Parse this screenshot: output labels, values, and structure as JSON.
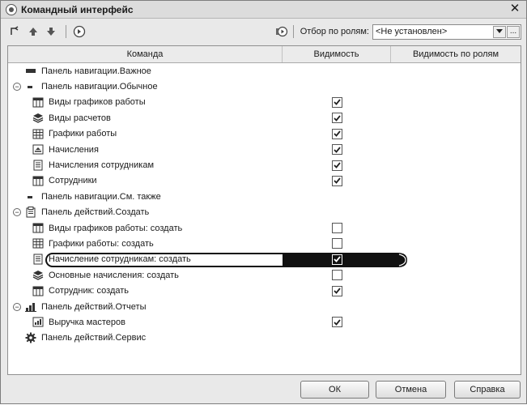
{
  "window": {
    "title": "Командный интерфейс"
  },
  "toolbar": {
    "filter_label": "Отбор по ролям:",
    "filter_value": "<Не установлен>"
  },
  "grid": {
    "headers": {
      "command": "Команда",
      "visibility": "Видимость",
      "role_visibility": "Видимость по ролям"
    },
    "rows": [
      {
        "label": "Панель навигации.Важное",
        "indent": 0,
        "expander": "",
        "icon": "panel-bar-icon",
        "check": null
      },
      {
        "label": "Панель навигации.Обычное",
        "indent": 0,
        "expander": "−",
        "icon": "panel-bar-small-icon",
        "check": null
      },
      {
        "label": "Виды графиков работы",
        "indent": 1,
        "expander": "",
        "icon": "catalog-icon",
        "check": true
      },
      {
        "label": "Виды расчетов",
        "indent": 1,
        "expander": "",
        "icon": "chart-of-calc-icon",
        "check": true
      },
      {
        "label": "Графики работы",
        "indent": 1,
        "expander": "",
        "icon": "register-icon",
        "check": true
      },
      {
        "label": "Начисления",
        "indent": 1,
        "expander": "",
        "icon": "calc-register-icon",
        "check": true
      },
      {
        "label": "Начисления сотрудникам",
        "indent": 1,
        "expander": "",
        "icon": "document-icon",
        "check": true
      },
      {
        "label": "Сотрудники",
        "indent": 1,
        "expander": "",
        "icon": "catalog-icon",
        "check": true
      },
      {
        "label": "Панель навигации.См. также",
        "indent": 0,
        "expander": "",
        "icon": "panel-bar-small-icon",
        "check": null
      },
      {
        "label": "Панель действий.Создать",
        "indent": 0,
        "expander": "−",
        "icon": "create-icon",
        "check": null
      },
      {
        "label": "Виды графиков работы: создать",
        "indent": 1,
        "expander": "",
        "icon": "catalog-icon",
        "check": false
      },
      {
        "label": "Графики работы: создать",
        "indent": 1,
        "expander": "",
        "icon": "register-icon",
        "check": false
      },
      {
        "label": "Начисление сотрудникам: создать",
        "indent": 1,
        "expander": "",
        "icon": "document-icon",
        "check": true,
        "selected": true
      },
      {
        "label": "Основные начисления: создать",
        "indent": 1,
        "expander": "",
        "icon": "chart-of-calc-icon",
        "check": false
      },
      {
        "label": "Сотрудник: создать",
        "indent": 1,
        "expander": "",
        "icon": "catalog-icon",
        "check": true
      },
      {
        "label": "Панель действий.Отчеты",
        "indent": 0,
        "expander": "−",
        "icon": "reports-icon",
        "check": null
      },
      {
        "label": "Выручка мастеров",
        "indent": 1,
        "expander": "",
        "icon": "report-icon",
        "check": true
      },
      {
        "label": "Панель действий.Сервис",
        "indent": 0,
        "expander": "",
        "icon": "gear-icon",
        "check": null
      }
    ]
  },
  "buttons": {
    "ok": "ОК",
    "cancel": "Отмена",
    "help": "Справка"
  },
  "colors": {
    "selection": "#111111",
    "window_bg": "#e9e9e9"
  }
}
